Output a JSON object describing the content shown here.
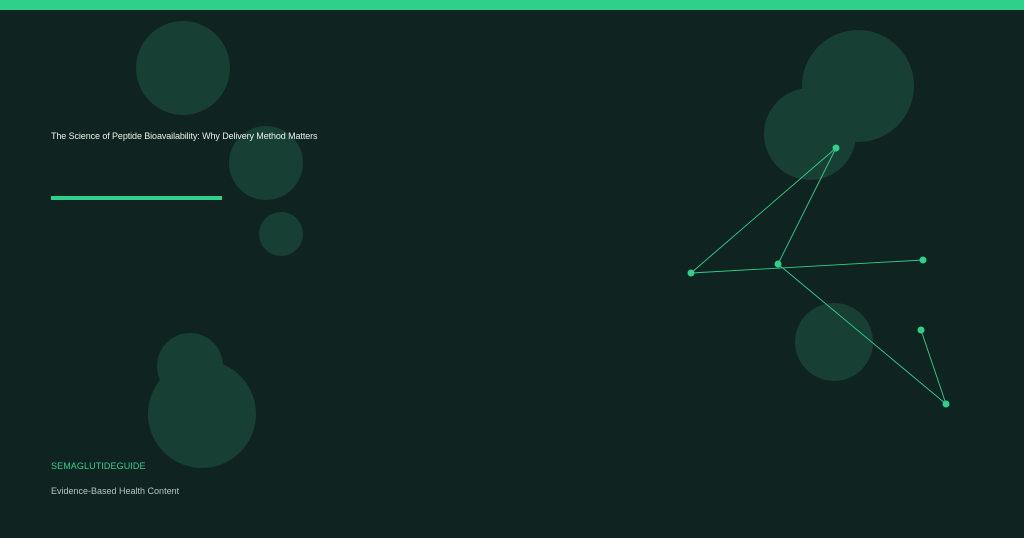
{
  "colors": {
    "background": "#0f2420",
    "accent": "#2fcf8c",
    "circle": "#173f33",
    "title_text": "#e8efec",
    "tagline_text": "#b6c3be"
  },
  "title": "The Science of Peptide Bioavailability: Why Delivery Method Matters",
  "brand": "SEMAGLUTIDEGUIDE",
  "tagline": "Evidence-Based Health Content"
}
